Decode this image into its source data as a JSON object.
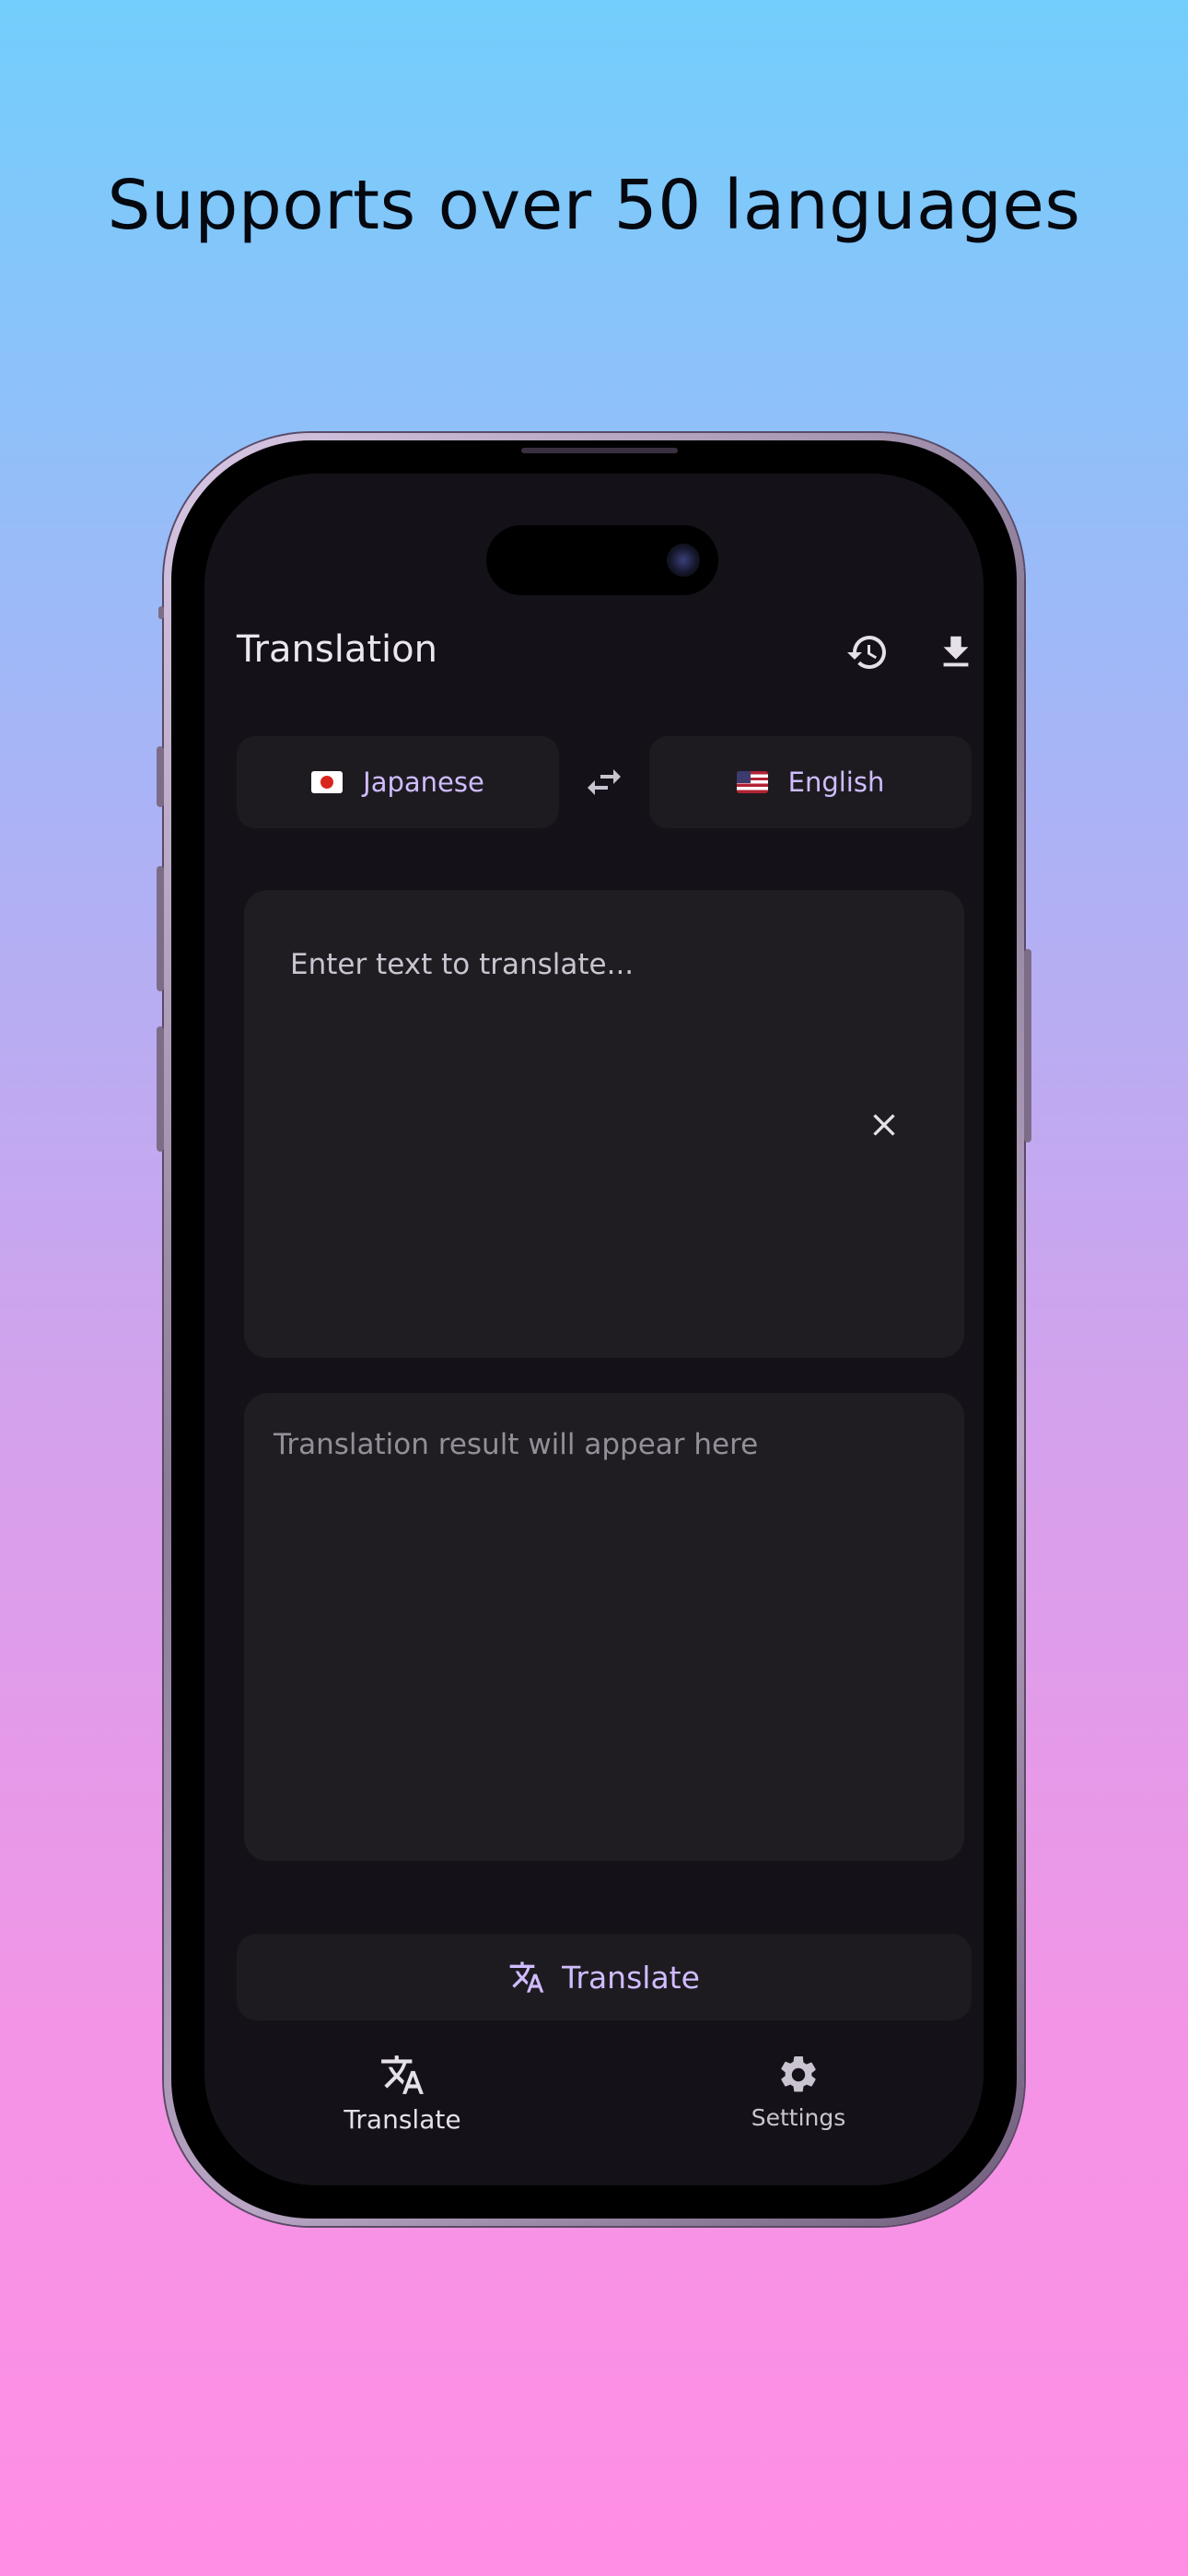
{
  "headline": "Supports over 50 languages",
  "app": {
    "title": "Translation",
    "history_icon": "history-icon",
    "download_icon": "download-icon"
  },
  "languages": {
    "source": {
      "label": "Japanese",
      "flag": "japan-flag-icon"
    },
    "target": {
      "label": "English",
      "flag": "us-flag-icon"
    },
    "swap_icon": "swap-arrows-icon"
  },
  "input": {
    "placeholder": "Enter text to translate...",
    "value": "",
    "clear_icon": "close-icon"
  },
  "result": {
    "placeholder": "Translation result will appear here"
  },
  "translate_button": {
    "label": "Translate",
    "icon": "translate-icon"
  },
  "bottom_nav": {
    "items": [
      {
        "label": "Translate",
        "icon": "translate-icon",
        "active": true
      },
      {
        "label": "Settings",
        "icon": "gear-icon",
        "active": false
      }
    ]
  },
  "colors": {
    "accent": "#d0bcff",
    "surface": "#1d1b20",
    "background": "#141218",
    "on_surface": "#e6e0e9",
    "muted": "#938f99"
  }
}
